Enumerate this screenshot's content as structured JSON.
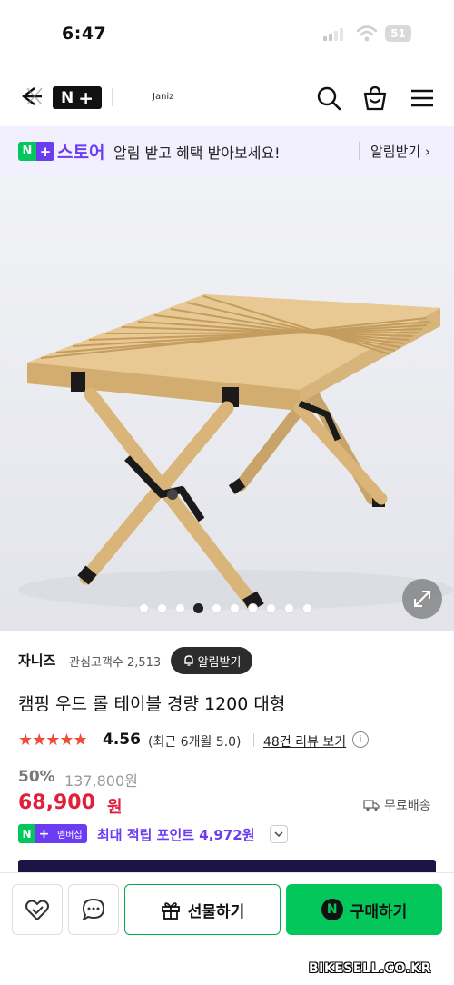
{
  "status_bar": {
    "time": "6:47",
    "battery": "51"
  },
  "nav": {
    "store_name": "Janiz",
    "logo_n": "N",
    "logo_plus": "+"
  },
  "banner": {
    "badge_n": "N",
    "badge_plus": "+",
    "store_label": "스토어",
    "message": "알림 받고 혜택 받아보세요!",
    "link_label": "알림받기 ›"
  },
  "carousel": {
    "total_images": 10,
    "active_index": 3
  },
  "seller": {
    "name": "자니즈",
    "followers": "관심고객수 2,513",
    "alert_button": "알림받기"
  },
  "product": {
    "title": "캠핑 우드 롤 테이블 경량 1200 대형",
    "rating": "4.56",
    "rating_recent": "(최근 6개월 5.0)",
    "review_link": "48건 리뷰 보기",
    "discount": "50%",
    "original_price": "137,800원",
    "price": "68,900",
    "price_unit": "원",
    "shipping": "무료배송"
  },
  "membership": {
    "badge_n": "N",
    "badge_plus": "+",
    "badge_text": "멤버십",
    "points_text": "최대 적립 포인트 4,972원"
  },
  "actions": {
    "gift_label": "선물하기",
    "buy_label": "구매하기",
    "buy_badge": "N"
  },
  "watermark": "BIKESELL.CO.KR",
  "colors": {
    "naver_green": "#03c75a",
    "plus_purple": "#6b3cf2",
    "price_red": "#e0203b",
    "star_red": "#f04b38"
  }
}
